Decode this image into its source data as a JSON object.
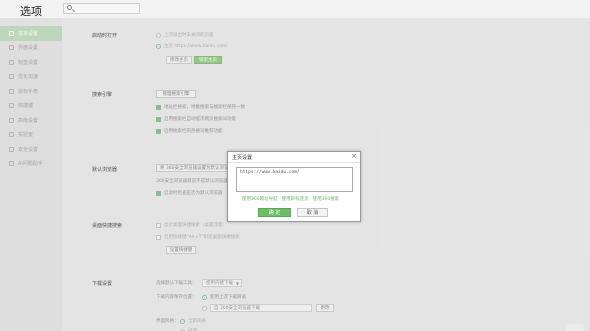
{
  "header": {
    "title": "选项",
    "search_placeholder": ""
  },
  "sidebar": {
    "items": [
      {
        "label": "基本设置",
        "active": true
      },
      {
        "label": "界面设置"
      },
      {
        "label": "标签设置"
      },
      {
        "label": "优化加速"
      },
      {
        "label": "鼠标手势"
      },
      {
        "label": "快捷键"
      },
      {
        "label": "高级设置"
      },
      {
        "label": "实验室"
      },
      {
        "label": "安全设置"
      },
      {
        "label": "AI问题助手"
      }
    ]
  },
  "startup": {
    "label": "启动时打开",
    "option_restore": "上次退出时未关闭的页面",
    "option_home": "主页 https://www.baidu.com/",
    "btn_change_home": "修改主页",
    "btn_lock_home": "锁定主页"
  },
  "search_engine": {
    "label": "搜索引擎",
    "btn_manage": "管理搜索引擎",
    "check1": "地址栏搜索，地推搜索与搜索栏保持一致",
    "check2": "启用搜索栏自动提示网页搜索词功能",
    "check3": "启用搜索栏的热搜词推荐功能"
  },
  "default_browser": {
    "label": "默认浏览器",
    "btn_set_default": "将 360安全浏览器设置为默认浏览器",
    "status_text": "360安全浏览器目前不是默认浏览器",
    "check_on_start": "启动时检查是否为默认浏览器"
  },
  "desktop_shortcut": {
    "label": "桌面快捷搜索",
    "check1": "显示桌面快捷搜索（桌面浮窗）",
    "check2": "启用快捷键“Alt+T”附近桌面快捷搜索",
    "btn_set": "设置快捷键"
  },
  "download": {
    "label": "下载设置",
    "tool_label": "选择默认下载工具：",
    "tool_value": "使用内建下载",
    "save_label": "下载内容保存位置：",
    "save_option1": "使用上次下载目录",
    "save_option2": "自 360安全浏览器下载",
    "btn_change": "更改",
    "interface_label": "界面风格：",
    "interface_option1": "全新风格",
    "interface_option2": "经典"
  },
  "dialog": {
    "title": "主页设置",
    "close_glyph": "×",
    "url_value": "https://www.baidu.com/",
    "link1": "使用360网址导航",
    "link2": "使用新标签页",
    "link3": "使用360搜索",
    "ok_label": "确 定",
    "cancel_label": "取 消"
  },
  "icons": {
    "search": "search-icon",
    "close": "close-icon"
  },
  "colors": {
    "accent": "#6ebd67",
    "sidebar_active": "#c3dec3"
  }
}
